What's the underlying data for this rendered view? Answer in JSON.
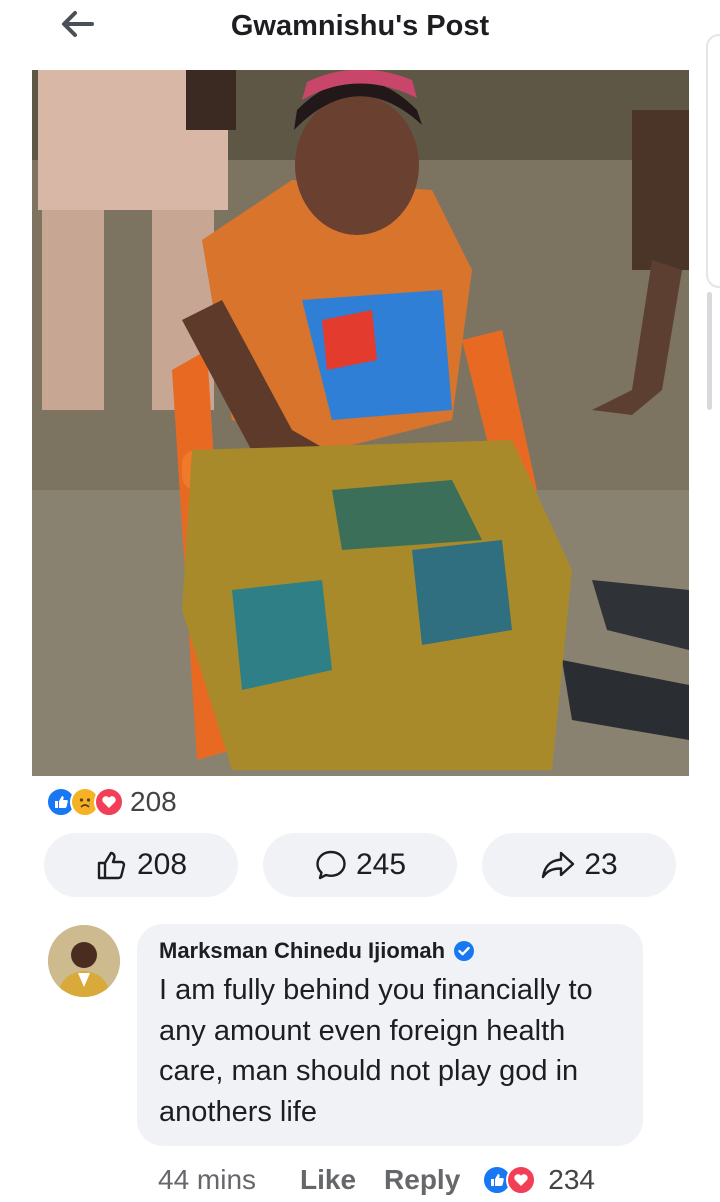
{
  "header": {
    "title": "Gwamnishu's Post"
  },
  "reactions": {
    "summary_count": "208"
  },
  "actions": {
    "like_count": "208",
    "comment_count": "245",
    "share_count": "23"
  },
  "comment": {
    "author": "Marksman Chinedu Ijiomah",
    "text": "I am fully behind you financially to any amount even foreign health care,  man should not play god in anothers life",
    "time": "44 mins",
    "like_label": "Like",
    "reply_label": "Reply",
    "reaction_count": "234"
  },
  "colors": {
    "accent": "#1877f2",
    "love": "#f33e58",
    "sad": "#f7b125",
    "pill_bg": "#f0f2f5"
  }
}
